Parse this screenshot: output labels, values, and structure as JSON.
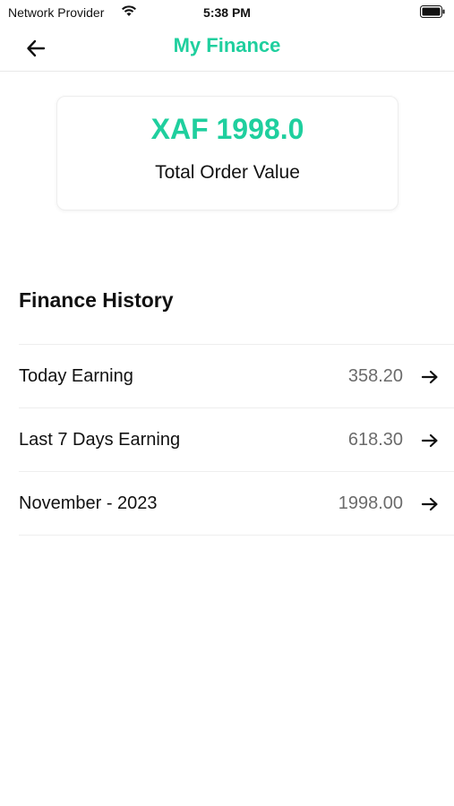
{
  "status_bar": {
    "carrier": "Network Provider",
    "time": "5:38 PM",
    "wifi_icon": "wifi-icon",
    "battery_icon": "battery-icon"
  },
  "header": {
    "title": "My Finance",
    "back_icon": "arrow-left-icon"
  },
  "summary": {
    "amount": "XAF 1998.0",
    "label": "Total Order Value"
  },
  "history": {
    "title": "Finance History",
    "rows": [
      {
        "label": "Today Earning",
        "value": "358.20",
        "icon": "arrow-right-icon"
      },
      {
        "label": "Last 7 Days Earning",
        "value": "618.30",
        "icon": "arrow-right-icon"
      },
      {
        "label": "November - 2023",
        "value": "1998.00",
        "icon": "arrow-right-icon"
      }
    ]
  },
  "colors": {
    "accent": "#1fcf9e",
    "text": "#111111",
    "muted": "#6b6b6b",
    "divider": "#eeeeee"
  }
}
